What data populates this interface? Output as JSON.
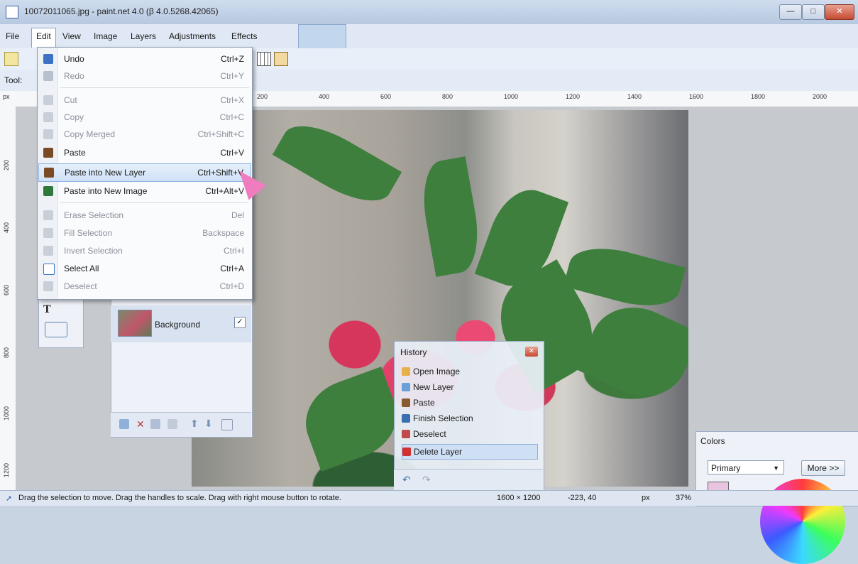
{
  "window": {
    "title": "10072011065.jpg - paint.net 4.0 (β 4.0.5268.42065)",
    "min_label": "—",
    "max_label": "□",
    "close_label": "✕"
  },
  "menubar": {
    "items": [
      "File",
      "Edit",
      "View",
      "Image",
      "Layers",
      "Adjustments",
      "Effects"
    ]
  },
  "toolbar": {
    "tool_label": "Tool:"
  },
  "ruler": {
    "unit": "px",
    "ticks": [
      "200",
      "400",
      "600",
      "800",
      "1000",
      "1200",
      "1400",
      "1600",
      "1800",
      "2000"
    ],
    "vticks": [
      "200",
      "400",
      "600",
      "800",
      "1000",
      "1200"
    ]
  },
  "edit_menu": {
    "items": [
      {
        "label": "Undo",
        "shortcut": "Ctrl+Z",
        "enabled": true
      },
      {
        "label": "Redo",
        "shortcut": "Ctrl+Y",
        "enabled": false
      },
      {
        "label": "Cut",
        "shortcut": "Ctrl+X",
        "enabled": false
      },
      {
        "label": "Copy",
        "shortcut": "Ctrl+C",
        "enabled": false
      },
      {
        "label": "Copy Merged",
        "shortcut": "Ctrl+Shift+C",
        "enabled": false
      },
      {
        "label": "Paste",
        "shortcut": "Ctrl+V",
        "enabled": true
      },
      {
        "label": "Paste into New Layer",
        "shortcut": "Ctrl+Shift+V",
        "enabled": true
      },
      {
        "label": "Paste into New Image",
        "shortcut": "Ctrl+Alt+V",
        "enabled": true
      },
      {
        "label": "Erase Selection",
        "shortcut": "Del",
        "enabled": false
      },
      {
        "label": "Fill Selection",
        "shortcut": "Backspace",
        "enabled": false
      },
      {
        "label": "Invert Selection",
        "shortcut": "Ctrl+I",
        "enabled": false
      },
      {
        "label": "Select All",
        "shortcut": "Ctrl+A",
        "enabled": true
      },
      {
        "label": "Deselect",
        "shortcut": "Ctrl+D",
        "enabled": false
      }
    ]
  },
  "layers": {
    "items": [
      {
        "name": "Background",
        "visible": true
      }
    ]
  },
  "history": {
    "title": "History",
    "items": [
      "Open Image",
      "New Layer",
      "Paste",
      "Finish Selection",
      "Deselect",
      "Delete Layer"
    ],
    "selected": "Delete Layer"
  },
  "colors": {
    "title": "Colors",
    "mode": "Primary",
    "more_label": "More >>",
    "primary_color": "#e8c4e0"
  },
  "status": {
    "hint": "Drag the selection to move. Drag the handles to scale. Drag with right mouse button to rotate.",
    "size": "1600 × 1200",
    "cursor": "-223, 40",
    "unit": "px",
    "zoom": "37%"
  },
  "colors_theme": {
    "accent": "#8db2e3",
    "highlight_bg": "#cfe1f7",
    "arrow": "#f07cc0"
  }
}
